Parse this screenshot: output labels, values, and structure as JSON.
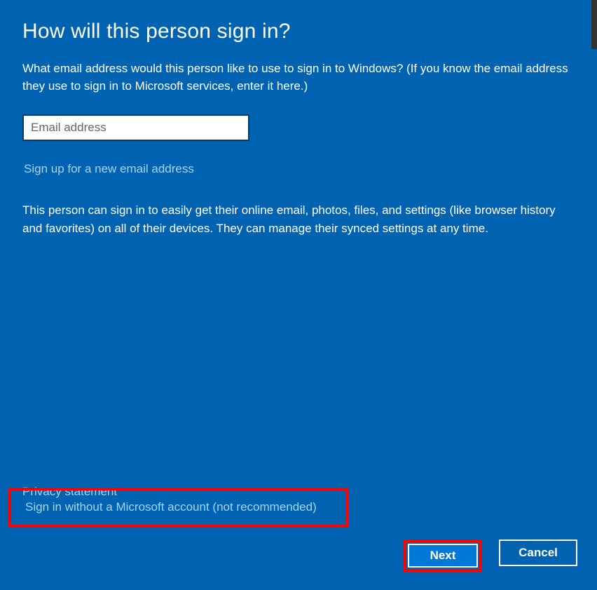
{
  "heading": "How will this person sign in?",
  "description": "What email address would this person like to use to sign in to Windows? (If you know the email address they use to sign in to Microsoft services, enter it here.)",
  "email": {
    "placeholder": "Email address",
    "value": ""
  },
  "links": {
    "signup": "Sign up for a new email address",
    "privacy": "Privacy statement",
    "no_account": "Sign in without a Microsoft account (not recommended)"
  },
  "info": "This person can sign in to easily get their online email, photos, files, and settings (like browser history and favorites) on all of their devices. They can manage their synced settings at any time.",
  "buttons": {
    "next": "Next",
    "cancel": "Cancel"
  }
}
